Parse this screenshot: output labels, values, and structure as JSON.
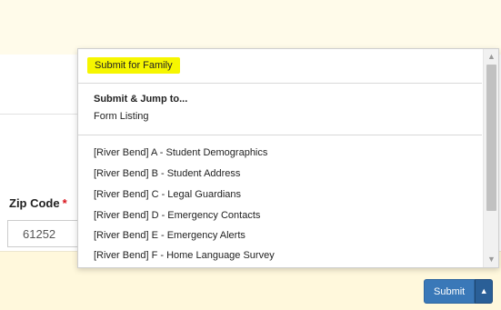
{
  "form": {
    "zip_label": "Zip Code",
    "required_marker": "*",
    "zip_value": "61252"
  },
  "dropdown": {
    "highlighted_item": "Submit for Family",
    "jump_header": "Submit & Jump to...",
    "form_listing": "Form Listing",
    "forms": [
      "[River Bend] A - Student Demographics",
      "[River Bend] B - Student Address",
      "[River Bend] C - Legal Guardians",
      "[River Bend] D - Emergency Contacts",
      "[River Bend] E - Emergency Alerts",
      "[River Bend] F - Home Language Survey"
    ],
    "scroll_up_icon": "▲",
    "scroll_down_icon": "▼"
  },
  "actions": {
    "submit_label": "Submit",
    "caret_icon": "▲"
  },
  "colors": {
    "highlight": "#f6f600",
    "primary_button": "#3a78b8",
    "required": "#d9121b",
    "panel_background": "#fffbea"
  }
}
